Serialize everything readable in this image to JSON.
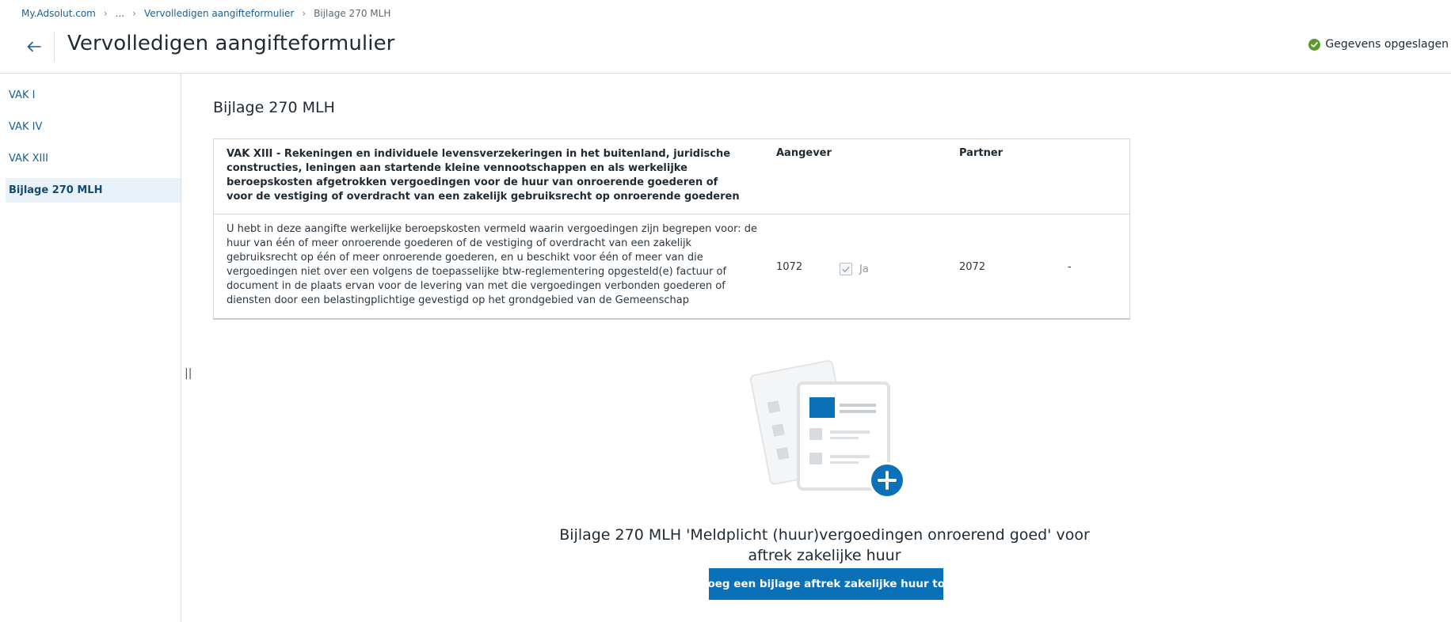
{
  "breadcrumb": {
    "items": [
      "My.Adsolut.com",
      "...",
      "Vervolledigen aangifteformulier"
    ],
    "current": "Bijlage 270 MLH"
  },
  "header": {
    "title": "Vervolledigen aangifteformulier",
    "save_status": "Gegevens opgeslagen"
  },
  "sidebar": {
    "items": [
      {
        "label": "VAK I"
      },
      {
        "label": "VAK IV"
      },
      {
        "label": "VAK XIII"
      },
      {
        "label": "Bijlage 270 MLH"
      }
    ],
    "active": "Bijlage 270 MLH"
  },
  "main": {
    "section_title": "Bijlage 270 MLH",
    "table": {
      "header_desc": "VAK XIII - Rekeningen en individuele levensverzekeringen in het buitenland, juridische constructies, leningen aan startende kleine vennootschappen en als werkelijke beroepskosten afgetrokken vergoedingen voor de huur van onroerende goederen of voor de vestiging of overdracht van een zakelijk gebruiksrecht op onroerende goederen",
      "col_aangever": "Aangever",
      "col_partner": "Partner",
      "row": {
        "desc": "U hebt in deze aangifte werkelijke beroepskosten vermeld waarin vergoedingen zijn begrepen voor: de huur van één of meer onroerende goederen of de vestiging of overdracht van een zakelijk gebruiksrecht op één of meer onroerende goederen, en u beschikt voor één of meer van die vergoedingen niet over een volgens de toepasselijke btw-reglementering opgesteld(e) factuur of document in de plaats ervan voor de levering van met die vergoedingen verbonden goederen of diensten door een belastingplichtige gevestigd op het grondgebied van de Gemeenschap",
        "code_aangever": "1072",
        "checkbox_label": "Ja",
        "checkbox_checked": true,
        "code_partner": "2072",
        "partner_value": "-"
      }
    },
    "empty_state": {
      "heading": "Bijlage 270 MLH 'Meldplicht (huur)vergoedingen onroerend goed' voor aftrek zakelijke huur",
      "button_label": "Voeg een bijlage aftrek zakelijke huur toe"
    },
    "resize_handle": "||"
  },
  "colors": {
    "primary": "#0a70b8",
    "link": "#1b5f8c",
    "success": "#5a9a2c",
    "active_bg": "#e9f2f9"
  },
  "icons": {
    "back": "arrow-left-icon",
    "status": "check-circle-icon",
    "add": "plus-circle-icon"
  }
}
